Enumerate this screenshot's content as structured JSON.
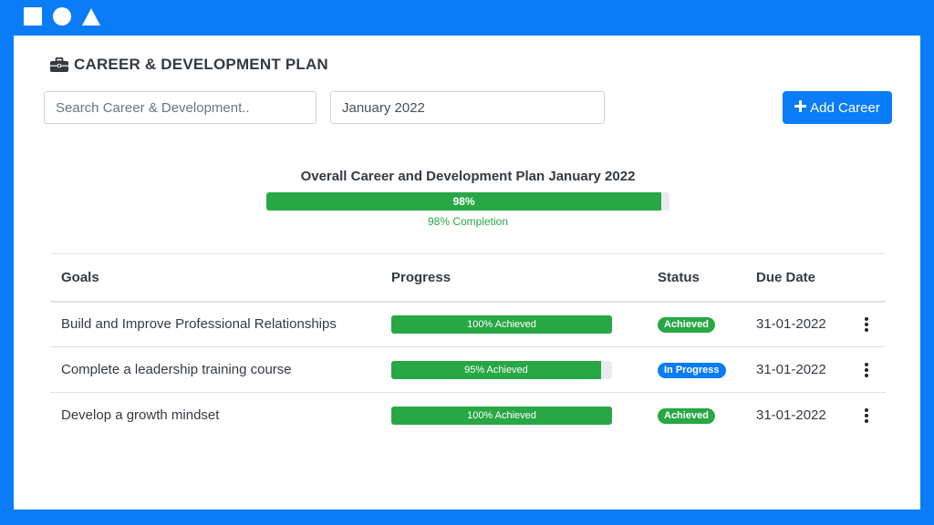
{
  "page": {
    "title": "CAREER & DEVELOPMENT PLAN",
    "title_icon": "briefcase-icon"
  },
  "filters": {
    "search_placeholder": "Search Career & Development..",
    "month_value": "January 2022"
  },
  "actions": {
    "add_label": "Add Career",
    "add_icon": "plus-icon"
  },
  "overall": {
    "title": "Overall Career and Development Plan January 2022",
    "percent": 98,
    "bar_label": "98%",
    "caption": "98% Completion"
  },
  "table": {
    "headers": [
      "Goals",
      "Progress",
      "Status",
      "Due Date"
    ],
    "rows": [
      {
        "goal": "Build and Improve Professional Relationships",
        "progress": 100,
        "progress_label": "100% Achieved",
        "status": "Achieved",
        "due": "31-01-2022"
      },
      {
        "goal": "Complete a leadership training course",
        "progress": 95,
        "progress_label": "95% Achieved",
        "status": "In Progress",
        "due": "31-01-2022"
      },
      {
        "goal": "Develop a growth mindset",
        "progress": 100,
        "progress_label": "100% Achieved",
        "status": "Achieved",
        "due": "31-01-2022"
      }
    ]
  },
  "colors": {
    "accent": "#0a7cf6",
    "success": "#28a745",
    "track": "#e9ecef"
  }
}
